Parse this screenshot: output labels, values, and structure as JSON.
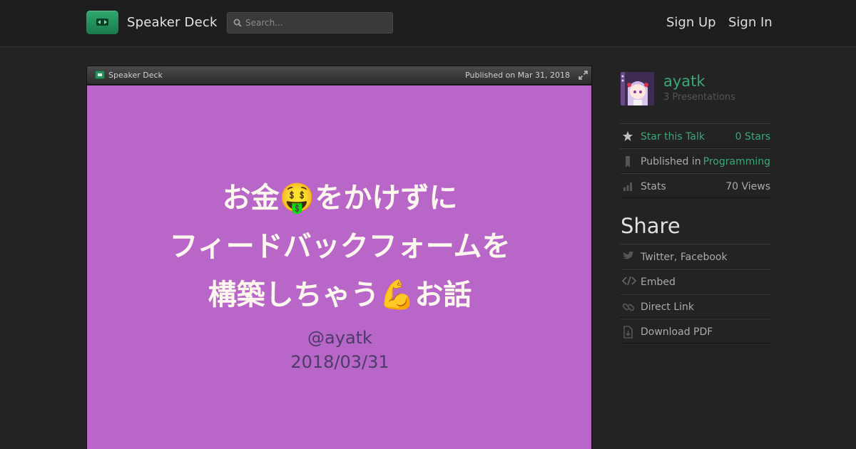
{
  "header": {
    "brand": "Speaker Deck",
    "search_placeholder": "Search...",
    "sign_up": "Sign Up",
    "sign_in": "Sign In"
  },
  "slide_bar": {
    "brand": "Speaker Deck",
    "published": "Published on Mar 31, 2018"
  },
  "slide": {
    "title_line1": "お金🤑をかけずに",
    "title_line2": "フィードバックフォームを",
    "title_line3": "構築しちゃう💪お話",
    "author": "@ayatk",
    "date": "2018/03/31",
    "background": "#b866c8"
  },
  "sidebar": {
    "username": "ayatk",
    "presentations": "3 Presentations",
    "star_label": "Star this Talk",
    "star_count": "0 Stars",
    "published_in_label": "Published in",
    "published_in_value": "Programming",
    "stats_label": "Stats",
    "stats_value": "70 Views",
    "share_heading": "Share",
    "share_items": [
      "Twitter, Facebook",
      "Embed",
      "Direct Link",
      "Download PDF"
    ]
  },
  "colors": {
    "accent_green": "#3aa876",
    "background": "#232323"
  }
}
